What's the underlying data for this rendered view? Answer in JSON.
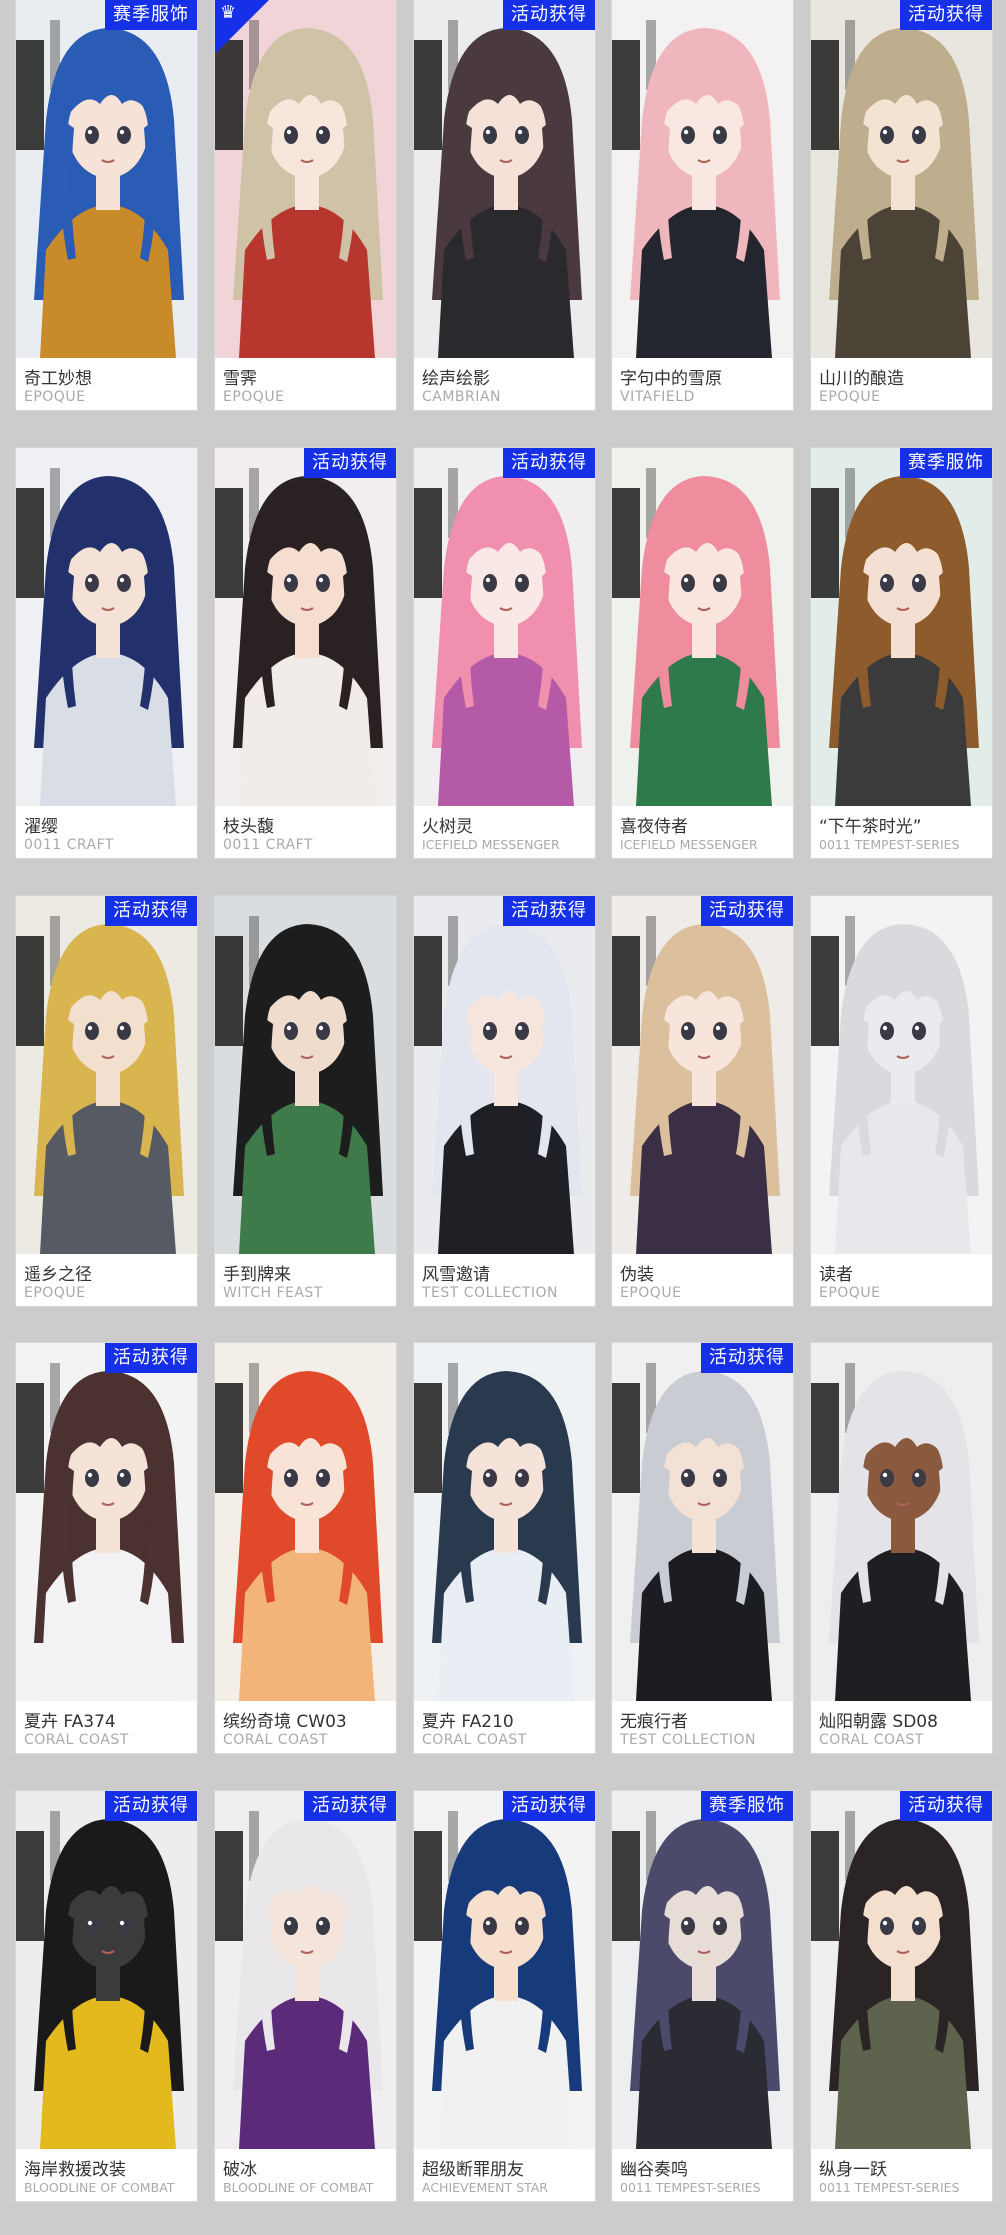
{
  "cards": [
    {
      "name": "奇工妙想",
      "series": "EPOQUE",
      "badge": "赛季服饰",
      "corner": false,
      "hair": "#2a5bb5",
      "outfit": "#c98a2a",
      "skin": "#f6e2d6",
      "bg": "#e9edf2"
    },
    {
      "name": "雪霁",
      "series": "EPOQUE",
      "badge": "",
      "corner": true,
      "hair": "#cfc2a6",
      "outfit": "#b7362e",
      "skin": "#f7e6dc",
      "bg": "#f1d4d8"
    },
    {
      "name": "绘声绘影",
      "series": "CAMBRIAN",
      "badge": "活动获得",
      "corner": false,
      "hair": "#4a3a3f",
      "outfit": "#2a2a2e",
      "skin": "#f5e1d8",
      "bg": "#ececec"
    },
    {
      "name": "字句中的雪原",
      "series": "VITAFIELD",
      "badge": "",
      "corner": false,
      "hair": "#f0b6bd",
      "outfit": "#23262f",
      "skin": "#f9e7e2",
      "bg": "#f3f1f1"
    },
    {
      "name": "山川的酿造",
      "series": "EPOQUE",
      "badge": "活动获得",
      "corner": false,
      "hair": "#bfae8d",
      "outfit": "#4b4336",
      "skin": "#f3e3d3",
      "bg": "#e9e6df"
    },
    {
      "name": "濯缨",
      "series": "0011 CRAFT",
      "badge": "",
      "corner": false,
      "hair": "#22306b",
      "outfit": "#d9dde6",
      "skin": "#f5e2d6",
      "bg": "#eef0f4"
    },
    {
      "name": "枝头馥",
      "series": "0011 CRAFT",
      "badge": "活动获得",
      "corner": false,
      "hair": "#2a2222",
      "outfit": "#f1ece8",
      "skin": "#f5ddd0",
      "bg": "#f2eeee"
    },
    {
      "name": "火树灵",
      "series": "ICEFIELD MESSENGER",
      "badge": "活动获得",
      "corner": false,
      "hair": "#f08fae",
      "outfit": "#b55aa6",
      "skin": "#fae8e6",
      "bg": "#f1eef2"
    },
    {
      "name": "喜夜侍者",
      "series": "ICEFIELD MESSENGER",
      "badge": "",
      "corner": false,
      "hair": "#ef8c9e",
      "outfit": "#2f7a4b",
      "skin": "#fae6df",
      "bg": "#eef1ec"
    },
    {
      "name": "“下午茶时光”",
      "series": "0011 TEMPEST-SERIES",
      "badge": "赛季服饰",
      "corner": false,
      "hair": "#8e5b2c",
      "outfit": "#3c3b3c",
      "skin": "#f4e0d2",
      "bg": "#e2ece9"
    },
    {
      "name": "遥乡之径",
      "series": "EPOQUE",
      "badge": "活动获得",
      "corner": false,
      "hair": "#d9b550",
      "outfit": "#555a63",
      "skin": "#f3dfce",
      "bg": "#eceae2"
    },
    {
      "name": "手到牌来",
      "series": "WITCH FEAST",
      "badge": "",
      "corner": false,
      "hair": "#1d1d1d",
      "outfit": "#3f7a4a",
      "skin": "#f0dccd",
      "bg": "#dadde0"
    },
    {
      "name": "风雪邀请",
      "series": "TEST COLLECTION",
      "badge": "活动获得",
      "corner": false,
      "hair": "#e3e6ee",
      "outfit": "#1f2026",
      "skin": "#f6e6de",
      "bg": "#e9ebef"
    },
    {
      "name": "伪装",
      "series": "EPOQUE",
      "badge": "活动获得",
      "corner": false,
      "hair": "#dcbf9d",
      "outfit": "#3a2f44",
      "skin": "#f7e4da",
      "bg": "#eeebe8"
    },
    {
      "name": "读者",
      "series": "EPOQUE",
      "badge": "",
      "corner": false,
      "hair": "#d8dade",
      "outfit": "#e6e8ec",
      "skin": "#e9ebee",
      "bg": "#f3f3f4"
    },
    {
      "name": "夏卉 FA374",
      "series": "CORAL COAST",
      "badge": "活动获得",
      "corner": false,
      "hair": "#4b3130",
      "outfit": "#f2f2f4",
      "skin": "#f6e3d8",
      "bg": "#f3f3f3"
    },
    {
      "name": "缤纷奇境 CW03",
      "series": "CORAL COAST",
      "badge": "",
      "corner": false,
      "hair": "#e04a2b",
      "outfit": "#f3b47a",
      "skin": "#f8e3d6",
      "bg": "#f4eee8"
    },
    {
      "name": "夏卉 FA210",
      "series": "CORAL COAST",
      "badge": "",
      "corner": false,
      "hair": "#2a3a4e",
      "outfit": "#e8eef3",
      "skin": "#f5e2d8",
      "bg": "#eef2f4"
    },
    {
      "name": "无痕行者",
      "series": "TEST COLLECTION",
      "badge": "活动获得",
      "corner": false,
      "hair": "#c9ccd2",
      "outfit": "#1c1d22",
      "skin": "#f3e1d6",
      "bg": "#f0f0f0"
    },
    {
      "name": "灿阳朝露 SD08",
      "series": "CORAL COAST",
      "badge": "",
      "corner": false,
      "hair": "#e3e3e8",
      "outfit": "#1f1f23",
      "skin": "#8b5a3e",
      "bg": "#eeeeee"
    },
    {
      "name": "海岸救援改装",
      "series": "BLOODLINE OF COMBAT",
      "badge": "活动获得",
      "corner": false,
      "hair": "#1a1a1a",
      "outfit": "#e3b91e",
      "skin": "#3b3b3b",
      "bg": "#ededed"
    },
    {
      "name": "破冰",
      "series": "BLOODLINE OF COMBAT",
      "badge": "活动获得",
      "corner": false,
      "hair": "#e9e7ea",
      "outfit": "#5b2b7a",
      "skin": "#f5e4dc",
      "bg": "#f0eef0"
    },
    {
      "name": "超级断罪朋友",
      "series": "ACHIEVEMENT STAR",
      "badge": "活动获得",
      "corner": false,
      "hair": "#173a7a",
      "outfit": "#f1f1f1",
      "skin": "#f6dfcc",
      "bg": "#f3f3f3"
    },
    {
      "name": "幽谷奏鸣",
      "series": "0011 TEMPEST-SERIES",
      "badge": "赛季服饰",
      "corner": false,
      "hair": "#4b4a6b",
      "outfit": "#2a2b33",
      "skin": "#e8ddd6",
      "bg": "#edeef0"
    },
    {
      "name": "纵身一跃",
      "series": "0011 TEMPEST-SERIES",
      "badge": "活动获得",
      "corner": false,
      "hair": "#2b2424",
      "outfit": "#5d634c",
      "skin": "#f4dfcf",
      "bg": "#eeeeee"
    }
  ]
}
